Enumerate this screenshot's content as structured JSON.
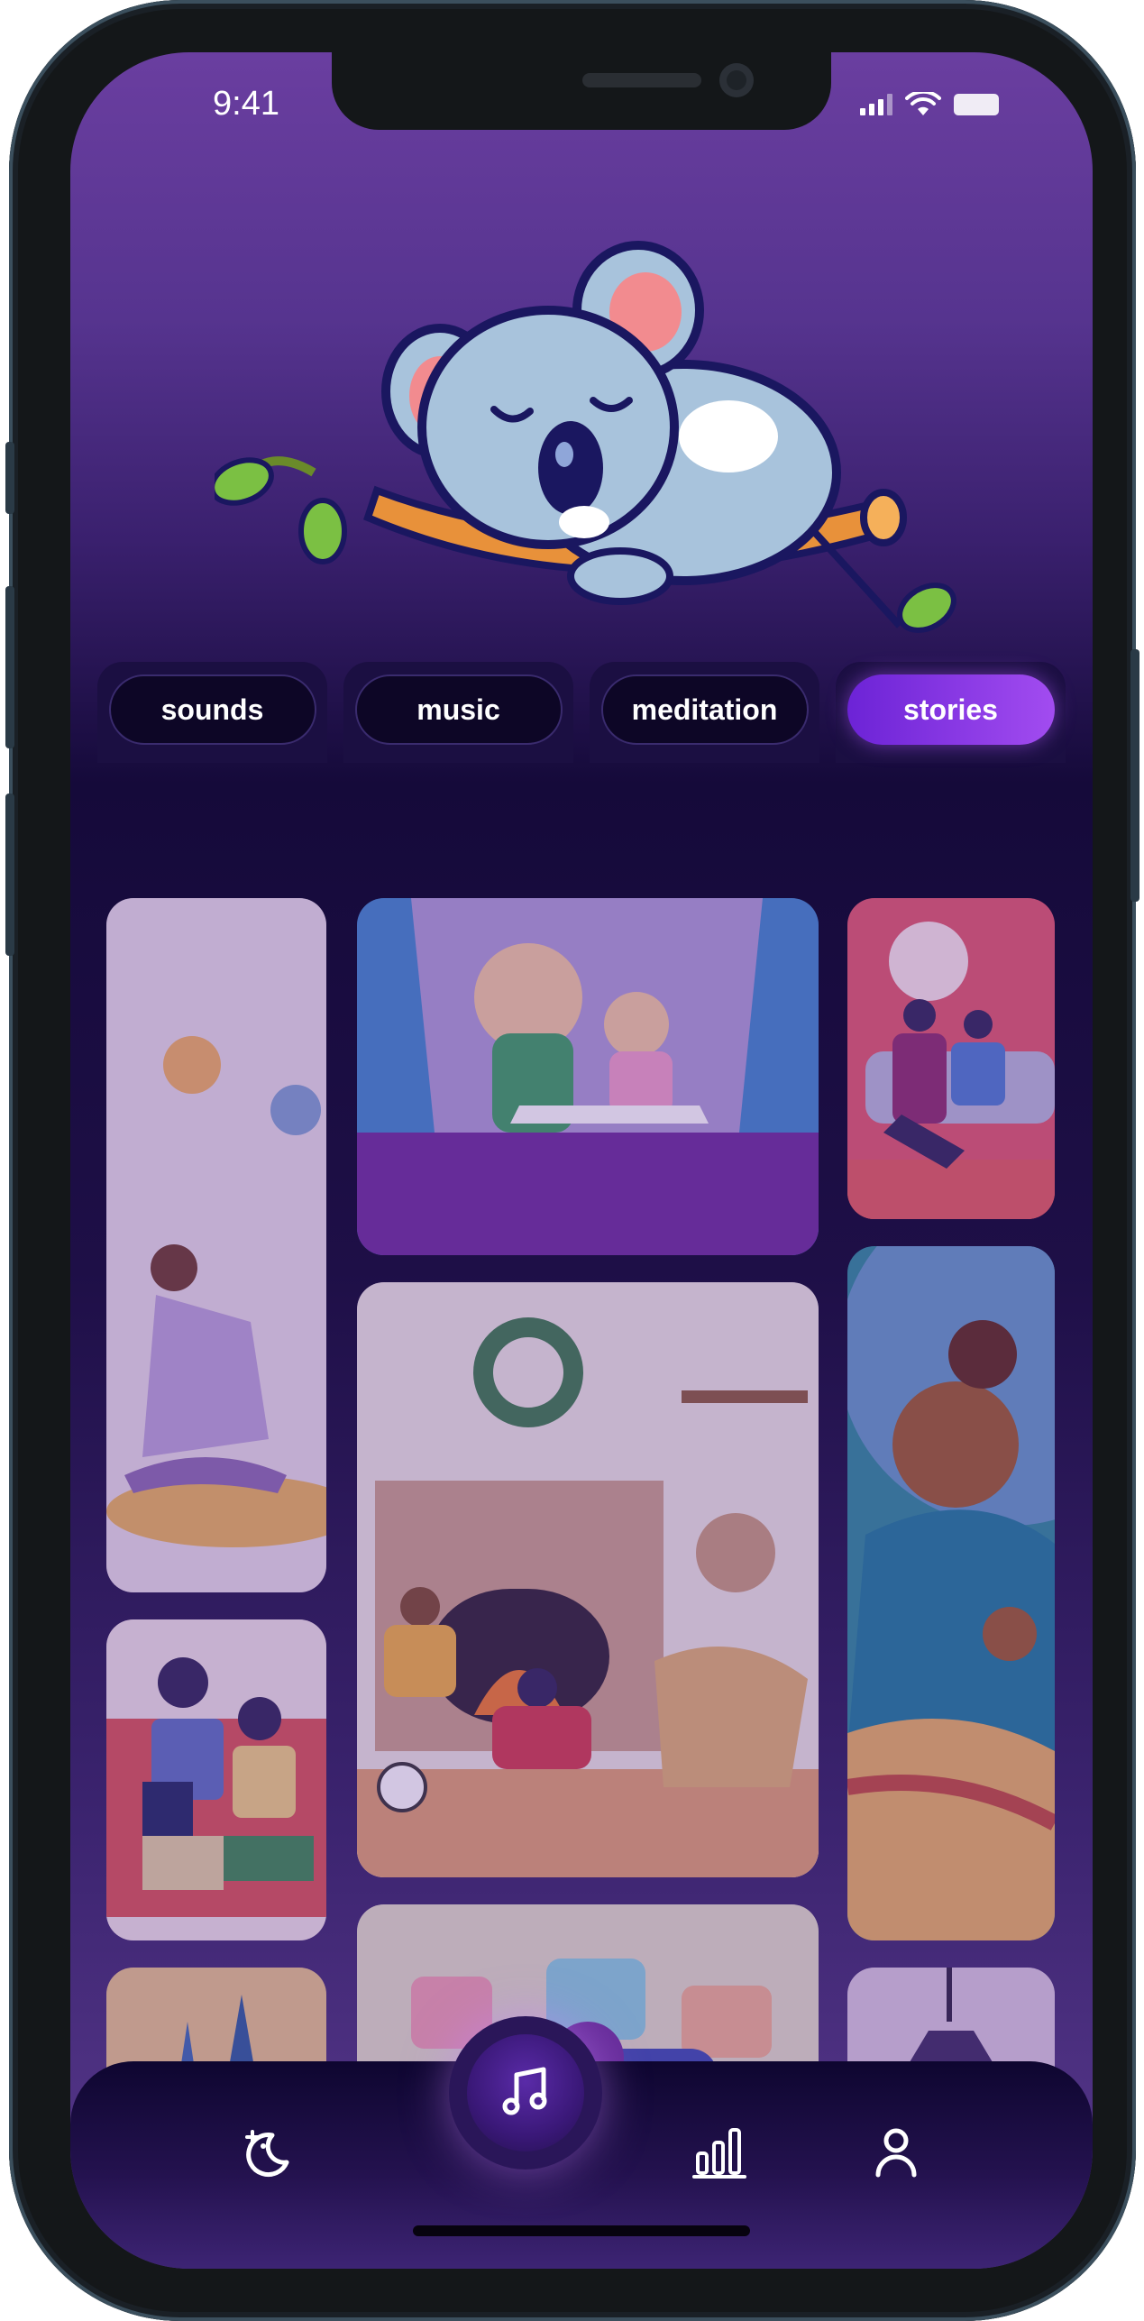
{
  "status_bar": {
    "time": "9:41"
  },
  "tabs": [
    {
      "label": "sounds",
      "active": false
    },
    {
      "label": "music",
      "active": false
    },
    {
      "label": "meditation",
      "active": false
    },
    {
      "label": "stories",
      "active": true
    }
  ],
  "nav": {
    "items": [
      {
        "name": "sleep",
        "icon": "moon-stars-icon"
      },
      {
        "name": "music",
        "icon": "music-note-icon",
        "active": true
      },
      {
        "name": "stats",
        "icon": "bar-chart-icon"
      },
      {
        "name": "profile",
        "icon": "user-icon"
      }
    ]
  },
  "colors": {
    "accent": "#a24cf0",
    "background_top": "#6a3ea0",
    "background_dark": "#150a3a",
    "tab_bg": "#0d0626"
  }
}
